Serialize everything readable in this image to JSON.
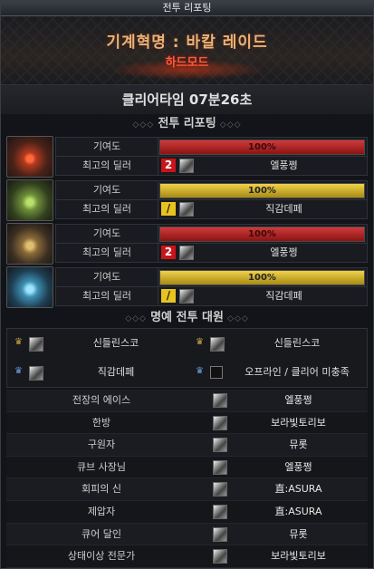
{
  "window": {
    "title": "전투 리포팅"
  },
  "hero": {
    "raid_title": "기계혁명 : 바칼 레이드",
    "difficulty": "하드모드"
  },
  "clear_time": "클리어타임  07분26초",
  "report_header": "전투 리포팅",
  "contribution_label": "기여도",
  "best_dealer_label": "최고의 딜러",
  "party_rows": [
    {
      "contribution_pct": 100,
      "contribution_text": "100%",
      "bar_color": "red",
      "badge": "2",
      "badge_color": "red",
      "dealer": "엘풍쩡"
    },
    {
      "contribution_pct": 100,
      "contribution_text": "100%",
      "bar_color": "yellow",
      "badge": "/",
      "badge_color": "yellow",
      "dealer": "직감데페"
    },
    {
      "contribution_pct": 100,
      "contribution_text": "100%",
      "bar_color": "red",
      "badge": "2",
      "badge_color": "red",
      "dealer": "엘풍쩡"
    },
    {
      "contribution_pct": 100,
      "contribution_text": "100%",
      "bar_color": "yellow",
      "badge": "/",
      "badge_color": "yellow",
      "dealer": "직감데페"
    }
  ],
  "honor_header": "명예 전투 대원",
  "honor": [
    {
      "name": "신들린스코"
    },
    {
      "name": "신들린스코"
    },
    {
      "name": "직감데페"
    },
    {
      "name": "오프라인 / 클리어 미충족"
    }
  ],
  "awards": [
    {
      "title": "전장의 에이스",
      "name": "엘풍쩡"
    },
    {
      "title": "한방",
      "name": "보라빛토리보"
    },
    {
      "title": "구원자",
      "name": "뮤롯"
    },
    {
      "title": "큐브 사장님",
      "name": "엘풍쩡"
    },
    {
      "title": "회피의 신",
      "name": "直:ASURA"
    },
    {
      "title": "제압자",
      "name": "直:ASURA"
    },
    {
      "title": "큐어 달인",
      "name": "뮤롯"
    },
    {
      "title": "상태이상 전문가",
      "name": "보라빛토리보"
    }
  ],
  "colors": {
    "red_bar": "#c8141a",
    "yellow_bar": "#e8c21e",
    "hard_mode": "#ff5a3a",
    "title_gold": "#e9b27a"
  },
  "icons": {
    "portrait_1": "red-beast-portrait",
    "portrait_2": "green-beast-portrait",
    "portrait_3": "gold-beast-portrait",
    "portrait_4": "blue-beast-portrait",
    "crown": "crown-icon"
  }
}
